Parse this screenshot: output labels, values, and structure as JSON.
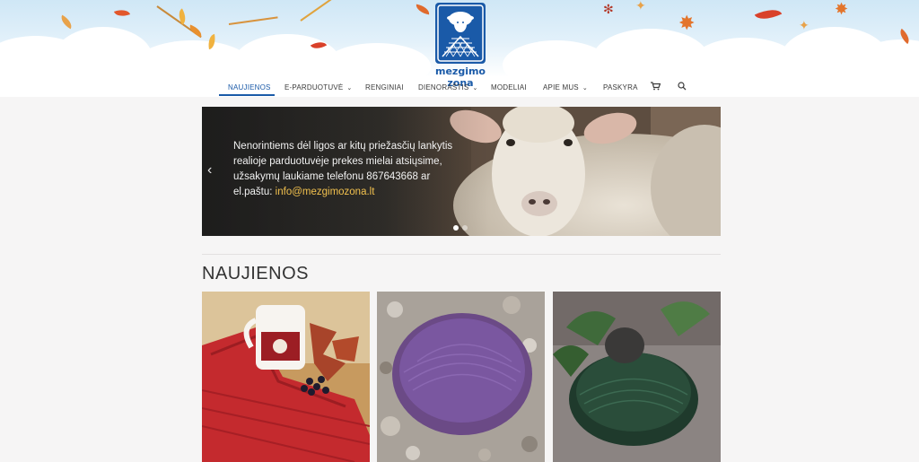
{
  "site": {
    "logo_text": "mezgimo zona"
  },
  "nav": {
    "items": [
      {
        "label": "NAUJIENOS",
        "active": true
      },
      {
        "label": "E-PARDUOTUVĖ",
        "dropdown": true
      },
      {
        "label": "RENGINIAI"
      },
      {
        "label": "DIENORAŠTIS",
        "dropdown": true
      },
      {
        "label": "MODELIAI"
      },
      {
        "label": "APIE MUS",
        "dropdown": true
      },
      {
        "label": "PASKYRA"
      }
    ],
    "cart_icon": "cart-icon",
    "search_icon": "search-icon",
    "accent_color": "#1a5aa8"
  },
  "slider": {
    "text": "Nenorintiems dėl ligos ar kitų priežasčių lankytis realioje parduotuvėje prekes mielai atsiųsime, užsakymų laukiame telefonu 867643668 ar el.paštu: ",
    "email": "info@mezgimozona.lt",
    "email_color": "#f2c14e",
    "prev_icon": "chevron-left-icon",
    "slides": 2,
    "current_slide": 1
  },
  "news": {
    "heading": "NAUJIENOS",
    "cards": [
      {
        "image": "red knitted scarf with mug and berries"
      },
      {
        "image": "purple yarn cake on pebbles"
      },
      {
        "image": "dark green yarn skein with leaves"
      }
    ]
  }
}
